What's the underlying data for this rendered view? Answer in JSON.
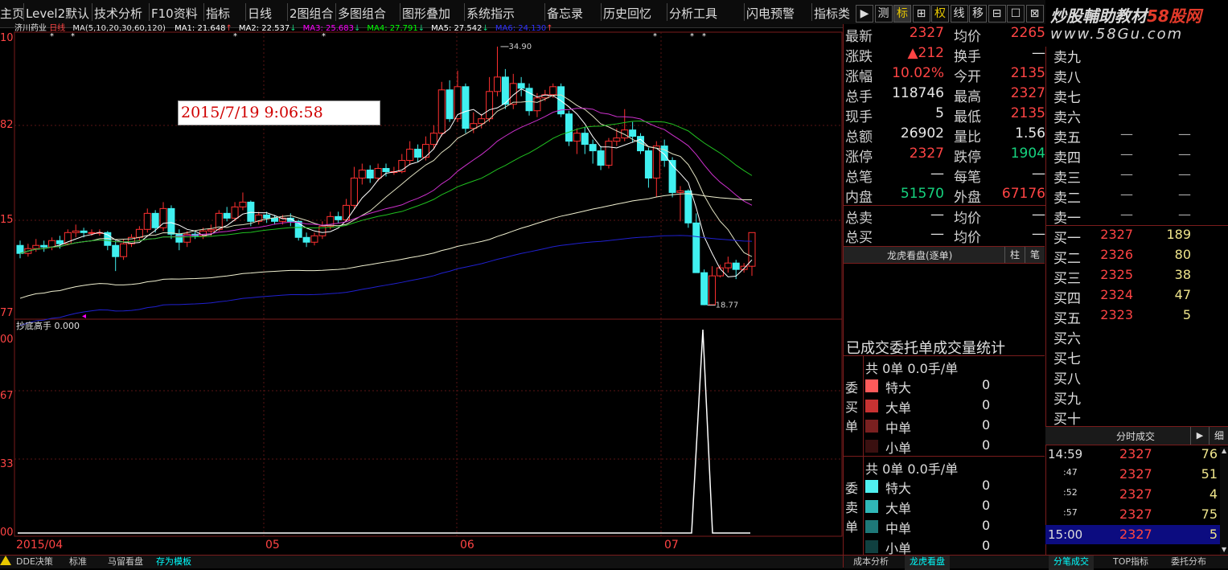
{
  "menu": {
    "items": [
      "主页",
      "Level2默认",
      "技术分析",
      "F10资料",
      "指标",
      "日线",
      "2图组合",
      "多图组合",
      "图形叠加",
      "系统指示",
      "备忘录",
      "历史回忆",
      "分析工具",
      "闪电预警",
      "指标类"
    ],
    "tool_buttons": [
      "▶",
      "测",
      "标",
      "⊞",
      "权",
      "线",
      "移",
      "⊟",
      "☐",
      "⊠"
    ]
  },
  "brand": {
    "name": "炒股輔助教材",
    "name_red": "58股网",
    "url": "www.58Gu.com"
  },
  "chart": {
    "stock_name": "济川药业",
    "period": "日线",
    "ma_params": "MA(5,10,20,30,60,120)",
    "ma_values": [
      {
        "label": "MA1: 21.648",
        "arrow": "↑",
        "color": "#ffffff"
      },
      {
        "label": "MA2: 22.537",
        "arrow": "↓",
        "color": "#ffffff"
      },
      {
        "label": "MA3: 25.683",
        "arrow": "↓",
        "color": "#ff00ff"
      },
      {
        "label": "MA4: 27.791",
        "arrow": "↓",
        "color": "#00ff00"
      },
      {
        "label": "MA5: 27.542",
        "arrow": "↓",
        "color": "#ffffff"
      },
      {
        "label": "MA6: 24.130",
        "arrow": "↑",
        "color": "#3030ff"
      }
    ],
    "high_label": "34.90",
    "low_label": "18.77",
    "timestamp": "2015/7/19 9:06:58",
    "indicator_label": "抄底高手 0.000",
    "x_labels": [
      "2015/04",
      "05",
      "06",
      "07"
    ],
    "y_labels_main": [
      "10",
      "82",
      "15",
      "77"
    ],
    "y_labels_sub": [
      "00",
      "67",
      "33",
      "00"
    ],
    "colors": {
      "up": "#ff3030",
      "down": "#40f0f0",
      "frame": "#7a1c1c"
    }
  },
  "chart_data": {
    "type": "candlestick",
    "title": "济川药业 日线",
    "y_range": [
      18.77,
      34.9
    ],
    "x_labels": [
      "2015/04",
      "05",
      "06",
      "07"
    ],
    "candles": [
      [
        22.5,
        22.0,
        22.8,
        21.7
      ],
      [
        22.0,
        22.3,
        22.6,
        21.8
      ],
      [
        22.3,
        22.5,
        22.9,
        22.1
      ],
      [
        22.5,
        22.4,
        22.8,
        22.1
      ],
      [
        22.4,
        22.8,
        23.0,
        22.2
      ],
      [
        22.8,
        22.6,
        23.1,
        22.3
      ],
      [
        22.6,
        23.3,
        23.5,
        22.5
      ],
      [
        23.3,
        23.4,
        23.8,
        23.0
      ],
      [
        23.4,
        23.3,
        23.6,
        23.0
      ],
      [
        23.3,
        23.3,
        23.5,
        23.1
      ],
      [
        23.3,
        23.3,
        23.5,
        23.1
      ],
      [
        23.3,
        22.5,
        23.4,
        22.2
      ],
      [
        22.5,
        21.8,
        22.8,
        20.9
      ],
      [
        21.8,
        22.6,
        22.9,
        21.6
      ],
      [
        22.6,
        23.0,
        23.2,
        22.4
      ],
      [
        23.0,
        23.5,
        23.7,
        22.8
      ],
      [
        23.5,
        24.5,
        24.8,
        23.3
      ],
      [
        24.5,
        23.6,
        24.7,
        23.3
      ],
      [
        23.6,
        24.8,
        25.2,
        23.4
      ],
      [
        24.8,
        23.2,
        25.0,
        22.9
      ],
      [
        23.2,
        22.7,
        23.5,
        22.2
      ],
      [
        22.7,
        23.2,
        23.4,
        22.4
      ],
      [
        23.2,
        23.1,
        23.4,
        22.9
      ],
      [
        23.1,
        23.4,
        23.6,
        22.9
      ],
      [
        23.4,
        23.5,
        23.8,
        23.1
      ],
      [
        23.5,
        24.5,
        24.7,
        23.4
      ],
      [
        24.5,
        24.2,
        24.9,
        24.0
      ],
      [
        24.2,
        24.9,
        25.2,
        24.0
      ],
      [
        24.9,
        25.2,
        25.8,
        24.7
      ],
      [
        25.2,
        24.0,
        25.3,
        23.7
      ],
      [
        24.0,
        24.4,
        24.6,
        23.8
      ],
      [
        24.4,
        24.2,
        24.6,
        23.9
      ],
      [
        24.2,
        24.0,
        24.4,
        23.8
      ],
      [
        24.0,
        24.2,
        24.4,
        23.8
      ],
      [
        24.2,
        24.0,
        24.5,
        23.7
      ],
      [
        24.0,
        23.0,
        24.1,
        22.8
      ],
      [
        23.0,
        22.7,
        23.3,
        22.4
      ],
      [
        22.7,
        23.1,
        23.3,
        22.5
      ],
      [
        23.1,
        23.7,
        24.0,
        22.9
      ],
      [
        23.7,
        24.3,
        24.6,
        23.5
      ],
      [
        24.3,
        24.1,
        24.6,
        23.9
      ],
      [
        24.1,
        25.0,
        25.4,
        24.0
      ],
      [
        25.0,
        26.7,
        27.4,
        24.8
      ],
      [
        26.7,
        27.2,
        27.6,
        26.3
      ],
      [
        27.2,
        26.7,
        27.5,
        26.4
      ],
      [
        26.7,
        27.3,
        27.6,
        26.5
      ],
      [
        27.3,
        27.1,
        27.6,
        26.8
      ],
      [
        27.1,
        27.1,
        27.4,
        26.9
      ],
      [
        27.1,
        27.8,
        28.2,
        27.0
      ],
      [
        27.8,
        28.5,
        29.0,
        27.5
      ],
      [
        28.5,
        28.0,
        28.8,
        27.7
      ],
      [
        28.0,
        28.8,
        29.3,
        27.8
      ],
      [
        28.8,
        29.5,
        30.0,
        28.5
      ],
      [
        29.5,
        32.2,
        32.7,
        29.3
      ],
      [
        32.2,
        30.4,
        32.8,
        30.2
      ],
      [
        30.4,
        32.4,
        33.4,
        30.2
      ],
      [
        32.4,
        29.8,
        32.6,
        29.5
      ],
      [
        29.8,
        30.1,
        30.8,
        29.5
      ],
      [
        30.1,
        30.4,
        30.7,
        29.8
      ],
      [
        30.4,
        32.1,
        33.0,
        30.2
      ],
      [
        32.1,
        33.0,
        34.9,
        31.8
      ],
      [
        33.0,
        31.3,
        33.5,
        31.0
      ],
      [
        31.3,
        32.6,
        33.2,
        31.0
      ],
      [
        32.6,
        32.3,
        33.0,
        31.8
      ],
      [
        32.3,
        30.9,
        32.6,
        30.6
      ],
      [
        30.9,
        31.7,
        32.0,
        30.5
      ],
      [
        31.7,
        31.9,
        32.2,
        31.5
      ],
      [
        31.9,
        32.4,
        32.6,
        31.7
      ],
      [
        32.4,
        30.7,
        32.6,
        30.5
      ],
      [
        30.7,
        29.0,
        30.9,
        28.7
      ],
      [
        29.0,
        29.5,
        29.8,
        28.2
      ],
      [
        29.5,
        28.8,
        29.9,
        28.2
      ],
      [
        28.8,
        28.4,
        29.1,
        27.6
      ],
      [
        28.4,
        27.5,
        28.7,
        27.2
      ],
      [
        27.5,
        29.0,
        29.2,
        27.3
      ],
      [
        29.0,
        29.2,
        29.8,
        28.7
      ],
      [
        29.2,
        29.7,
        31.0,
        29.0
      ],
      [
        29.7,
        29.3,
        30.2,
        28.9
      ],
      [
        29.3,
        28.4,
        29.5,
        28.2
      ],
      [
        28.4,
        26.7,
        28.6,
        26.1
      ],
      [
        26.7,
        28.7,
        29.0,
        25.5
      ],
      [
        28.7,
        27.8,
        29.1,
        27.4
      ],
      [
        27.8,
        25.8,
        28.0,
        25.5
      ],
      [
        25.8,
        25.9,
        26.2,
        24.0
      ],
      [
        25.9,
        23.9,
        26.0,
        23.6
      ],
      [
        23.9,
        20.8,
        24.5,
        20.8
      ],
      [
        20.8,
        18.8,
        21.0,
        18.77
      ],
      [
        18.8,
        20.6,
        21.2,
        18.9
      ],
      [
        20.6,
        21.1,
        21.3,
        20.5
      ],
      [
        21.1,
        21.4,
        21.8,
        20.8
      ],
      [
        21.4,
        21.0,
        21.6,
        20.4
      ],
      [
        21.0,
        21.2,
        21.4,
        20.8
      ],
      [
        21.2,
        23.3,
        23.3,
        20.6
      ]
    ]
  },
  "quote": {
    "rows": [
      {
        "l1": "最新",
        "v1": "2327",
        "c1": "red",
        "l2": "均价",
        "v2": "2265",
        "c2": "red"
      },
      {
        "l1": "涨跌",
        "v1": "▲212",
        "c1": "red",
        "l2": "换手",
        "v2": "—",
        "c2": "white"
      },
      {
        "l1": "涨幅",
        "v1": "10.02%",
        "c1": "red",
        "l2": "今开",
        "v2": "2135",
        "c2": "red"
      },
      {
        "l1": "总手",
        "v1": "118746",
        "c1": "white",
        "l2": "最高",
        "v2": "2327",
        "c2": "red"
      },
      {
        "l1": "现手",
        "v1": "5",
        "c1": "white",
        "l2": "最低",
        "v2": "2135",
        "c2": "red"
      },
      {
        "l1": "总额",
        "v1": "26902",
        "c1": "white",
        "l2": "量比",
        "v2": "1.56",
        "c2": "white"
      },
      {
        "l1": "涨停",
        "v1": "2327",
        "c1": "red",
        "l2": "跌停",
        "v2": "1904",
        "c2": "green"
      },
      {
        "l1": "总笔",
        "v1": "—",
        "c1": "white",
        "l2": "每笔",
        "v2": "—",
        "c2": "white"
      },
      {
        "l1": "内盘",
        "v1": "51570",
        "c1": "green",
        "l2": "外盘",
        "v2": "67176",
        "c2": "red"
      },
      {
        "l1": "总卖",
        "v1": "—",
        "c1": "white",
        "l2": "均价",
        "v2": "—",
        "c2": "white"
      },
      {
        "l1": "总买",
        "v1": "—",
        "c1": "white",
        "l2": "均价",
        "v2": "—",
        "c2": "white"
      }
    ]
  },
  "dragon": {
    "tab_title": "龙虎看盘(逐单)",
    "tabs": [
      "柱",
      "笔"
    ],
    "stats_title": "已成交委托单成交量统计",
    "buy": {
      "header": "共 0单 0.0手/单",
      "side": "委买单",
      "rows": [
        {
          "label": "特大",
          "val": "0",
          "color": "#ff5a5a"
        },
        {
          "label": "大单",
          "val": "0",
          "color": "#c83232"
        },
        {
          "label": "中单",
          "val": "0",
          "color": "#7a2020"
        },
        {
          "label": "小单",
          "val": "0",
          "color": "#3a1010"
        }
      ]
    },
    "sell": {
      "header": "共 0单 0.0手/单",
      "side": "委卖单",
      "rows": [
        {
          "label": "特大",
          "val": "0",
          "color": "#50f0f0"
        },
        {
          "label": "大单",
          "val": "0",
          "color": "#30b8b8"
        },
        {
          "label": "中单",
          "val": "0",
          "color": "#1e7878"
        },
        {
          "label": "小单",
          "val": "0",
          "color": "#104040"
        }
      ]
    }
  },
  "book": {
    "asks": [
      {
        "label": "卖九",
        "price": "",
        "vol": ""
      },
      {
        "label": "卖八",
        "price": "",
        "vol": ""
      },
      {
        "label": "卖七",
        "price": "",
        "vol": ""
      },
      {
        "label": "卖六",
        "price": "",
        "vol": ""
      },
      {
        "label": "卖五",
        "price": "—",
        "vol": "—"
      },
      {
        "label": "卖四",
        "price": "—",
        "vol": "—"
      },
      {
        "label": "卖三",
        "price": "—",
        "vol": "—"
      },
      {
        "label": "卖二",
        "price": "—",
        "vol": "—"
      },
      {
        "label": "卖一",
        "price": "—",
        "vol": "—"
      }
    ],
    "bids": [
      {
        "label": "买一",
        "price": "2327",
        "vol": "189"
      },
      {
        "label": "买二",
        "price": "2326",
        "vol": "80"
      },
      {
        "label": "买三",
        "price": "2325",
        "vol": "38"
      },
      {
        "label": "买四",
        "price": "2324",
        "vol": "47"
      },
      {
        "label": "买五",
        "price": "2323",
        "vol": "5"
      },
      {
        "label": "买六",
        "price": "",
        "vol": ""
      },
      {
        "label": "买七",
        "price": "",
        "vol": ""
      },
      {
        "label": "买八",
        "price": "",
        "vol": ""
      },
      {
        "label": "买九",
        "price": "",
        "vol": ""
      },
      {
        "label": "买十",
        "price": "",
        "vol": ""
      }
    ]
  },
  "ticks": {
    "title": "分时成交",
    "btn": "细",
    "rows": [
      {
        "time": "14:59",
        "price": "2327",
        "vol": "76",
        "hl": false
      },
      {
        "time": ":47",
        "price": "2327",
        "vol": "51",
        "hl": false
      },
      {
        "time": ":52",
        "price": "2327",
        "vol": "4",
        "hl": false
      },
      {
        "time": ":57",
        "price": "2327",
        "vol": "75",
        "hl": false
      },
      {
        "time": "15:00",
        "price": "2327",
        "vol": "5",
        "hl": true
      }
    ]
  },
  "bottom_tabs": {
    "left": [
      "DDE决策",
      "标准",
      "马留看盘",
      "存为模板"
    ],
    "mid": [
      "成本分析",
      "龙虎看盘"
    ],
    "right": [
      "分笔成交",
      "TOP指标",
      "委托分布"
    ]
  }
}
